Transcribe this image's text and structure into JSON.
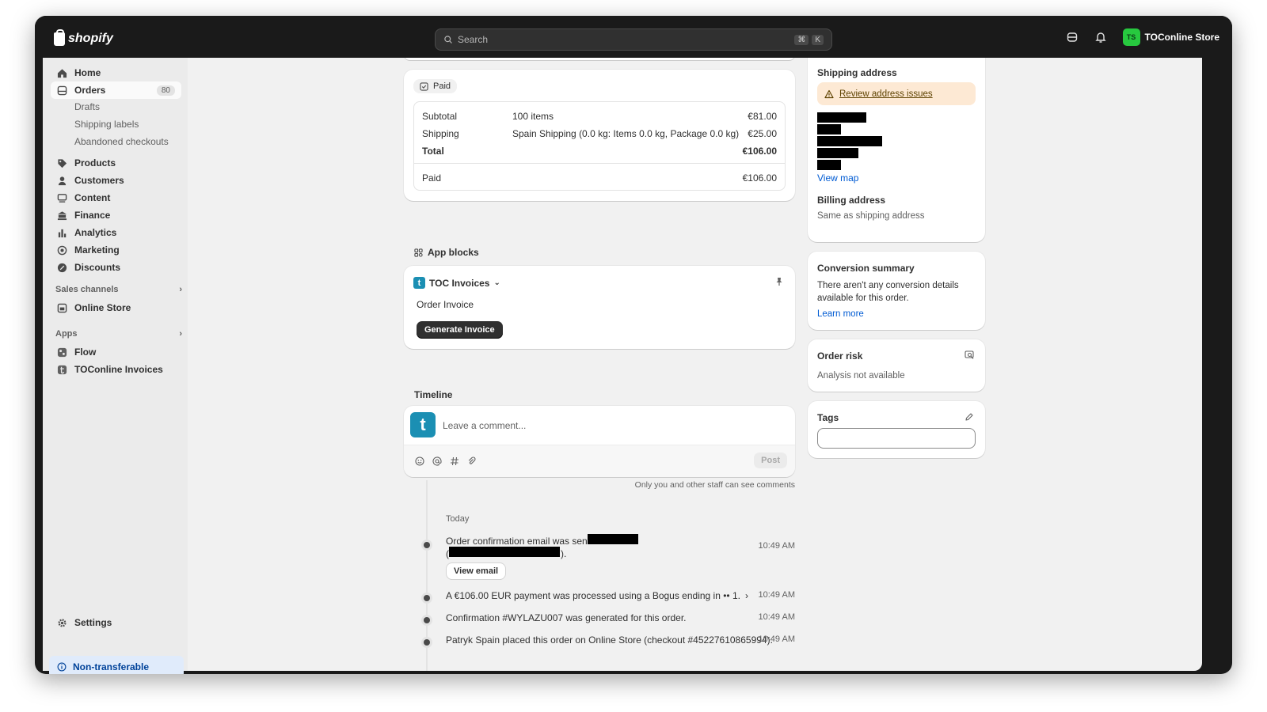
{
  "topbar": {
    "brand": "shopify",
    "search_placeholder": "Search",
    "shortcut_keys": [
      "⌘",
      "K"
    ],
    "store_initials": "TS",
    "store_name": "TOConline Store"
  },
  "sidebar": {
    "items": [
      {
        "label": "Home",
        "icon": "home-icon"
      },
      {
        "label": "Orders",
        "icon": "orders-icon",
        "count": "80"
      },
      {
        "label": "Products",
        "icon": "tag-icon"
      },
      {
        "label": "Customers",
        "icon": "person-icon"
      },
      {
        "label": "Content",
        "icon": "content-icon"
      },
      {
        "label": "Finance",
        "icon": "bank-icon"
      },
      {
        "label": "Analytics",
        "icon": "bar-chart-icon"
      },
      {
        "label": "Marketing",
        "icon": "target-icon"
      },
      {
        "label": "Discounts",
        "icon": "discount-icon"
      }
    ],
    "order_subitems": [
      "Drafts",
      "Shipping labels",
      "Abandoned checkouts"
    ],
    "sales_channels_title": "Sales channels",
    "sales_channels": [
      {
        "label": "Online Store"
      }
    ],
    "apps_title": "Apps",
    "apps": [
      {
        "label": "Flow"
      },
      {
        "label": "TOConline Invoices"
      }
    ],
    "settings_label": "Settings",
    "nontransferable_label": "Non-transferable"
  },
  "payment": {
    "status": "Paid",
    "subtotal_label": "Subtotal",
    "subtotal_detail": "100 items",
    "subtotal_amount": "€81.00",
    "shipping_label": "Shipping",
    "shipping_detail": "Spain Shipping (0.0 kg: Items 0.0 kg, Package 0.0 kg)",
    "shipping_amount": "€25.00",
    "total_label": "Total",
    "total_amount": "€106.00",
    "paid_label": "Paid",
    "paid_amount": "€106.00"
  },
  "app_blocks": {
    "title": "App blocks",
    "app_name": "TOC Invoices",
    "block_title": "Order Invoice",
    "button_label": "Generate Invoice"
  },
  "timeline": {
    "title": "Timeline",
    "comment_placeholder": "Leave a comment...",
    "post_label": "Post",
    "staff_note": "Only you and other staff can see comments",
    "day_label": "Today",
    "events": [
      {
        "text": "Order confirmation email was sent to",
        "time": "10:49 AM",
        "button": "View email"
      },
      {
        "text": "A €106.00 EUR payment was processed using a Bogus ending in •• 1.",
        "time": "10:49 AM"
      },
      {
        "text": "Confirmation #WYLAZU007 was generated for this order.",
        "time": "10:49 AM"
      },
      {
        "text": "Patryk Spain placed this order on Online Store (checkout #45227610865994).",
        "time": "10:49 AM"
      }
    ]
  },
  "right": {
    "shipping_title": "Shipping address",
    "review_issues": "Review address issues",
    "view_map": "View map",
    "billing_title": "Billing address",
    "billing_value": "Same as shipping address",
    "conversion_title": "Conversion summary",
    "conversion_text": "There aren't any conversion details available for this order.",
    "learn_more": "Learn more",
    "risk_title": "Order risk",
    "risk_text": "Analysis not available",
    "tags_title": "Tags"
  }
}
